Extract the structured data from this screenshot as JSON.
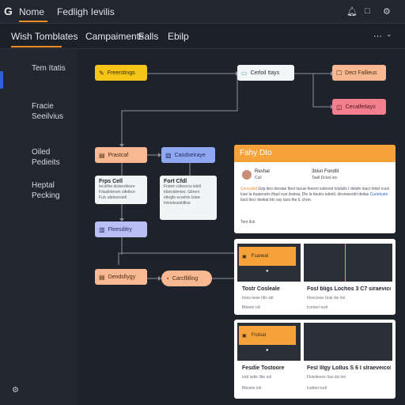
{
  "topbar": {
    "logo": "G",
    "tabs": [
      "Nome",
      "Fedligh Ievilis"
    ],
    "icons": [
      "bell-icon",
      "window-icon",
      "settings-icon"
    ]
  },
  "menubar": {
    "items": [
      "Wish Tomblates",
      "Campaiments",
      "Falls",
      "Ebilp"
    ],
    "right_icons": [
      "more-icon",
      "chevron-down-icon"
    ]
  },
  "sidebar": {
    "items": [
      "Tem Itatis",
      "Fracie\nSeeilvius",
      "Oiled\nPedieits",
      "Heptal\nPecking"
    ],
    "bottom_icon": "settings-icon"
  },
  "flow": {
    "nodes": [
      {
        "id": "n1",
        "label": "Freerstings",
        "icon": "✎"
      },
      {
        "id": "n2",
        "label": "Cerloil Itays",
        "icon": "▭"
      },
      {
        "id": "n3",
        "label": "Dect Fallieus",
        "icon": "☐"
      },
      {
        "id": "n4",
        "label": "Cecalfeitays",
        "icon": "◫"
      },
      {
        "id": "n5",
        "label": "Prastcaf",
        "icon": "▤"
      },
      {
        "id": "n6",
        "label": "Caodseiraye",
        "icon": "▧"
      },
      {
        "id": "n7",
        "label": "Fleesditry",
        "icon": "▥"
      },
      {
        "id": "n8",
        "label": "Dendsfiygy",
        "icon": "▤"
      },
      {
        "id": "n9",
        "label": "Carcflilling",
        "icon": "◔"
      }
    ],
    "card1": {
      "title": "Frps Cell",
      "lines": [
        "Iecsifire dicterellvore",
        "Fdaslintroen oifellesi",
        "Fulc aleteorsiefi"
      ]
    },
    "card2": {
      "title": "Fort Cfdl",
      "lines": [
        "Frsteir cdteecos lekitl",
        "ldsevidimieo. Gitreni",
        "ettogle ecrelnis lsiwe",
        "Inlsiotsuieldlioe"
      ]
    }
  },
  "panel": {
    "title": "Fahy Dto",
    "author": "Reshal",
    "author_sub": "Cuil",
    "meta": "3bisn Fondtll",
    "meta_sub": "Taall Dcaol sis",
    "body_key": "Ceroulistl",
    "body": "Gsp iteo dsrsiae ftesl tseuw fesrerl ssleroot ivtslsils I dolsfe loaci rtnlel rcssl luse la ttuaieralrs iftasI ruoi ilsstrai, Dlo la fieutrs ietietil, dirsneiesitrl deilas",
    "body_link": "Curietvats",
    "body_end": "bsol ltecr ibeiiiat btv ssy iaos the ll, chon.",
    "footer": "Tent lluii"
  },
  "templates": [
    {
      "title": "Tostr Cosleale",
      "sub": "Itoos tesie Iltls sdi",
      "badge": "Fsaneal",
      "footer": "Bltooer loli"
    },
    {
      "title": "Fosl bligs Lochos 3 C7 siraevicol",
      "sub": "Flsecisiss Itoal dsi lrsl",
      "badge": "",
      "footer": "Icsnteri lceil"
    },
    {
      "title": "Fesdie Tostoore",
      "sub": "Iotd isdie Iltie sdi",
      "badge": "Frotsal",
      "footer": "Bltoolsr loli"
    },
    {
      "title": "Fesl lllgy Lollus S 6 I slraeveicol",
      "sub": "Flstelieeos Itas dsi lrsl",
      "badge": "",
      "footer": "Icetteri lceil"
    }
  ],
  "colors": {
    "accent": "#f08a24",
    "selection": "#2a62d6",
    "background": "#1f232b"
  }
}
